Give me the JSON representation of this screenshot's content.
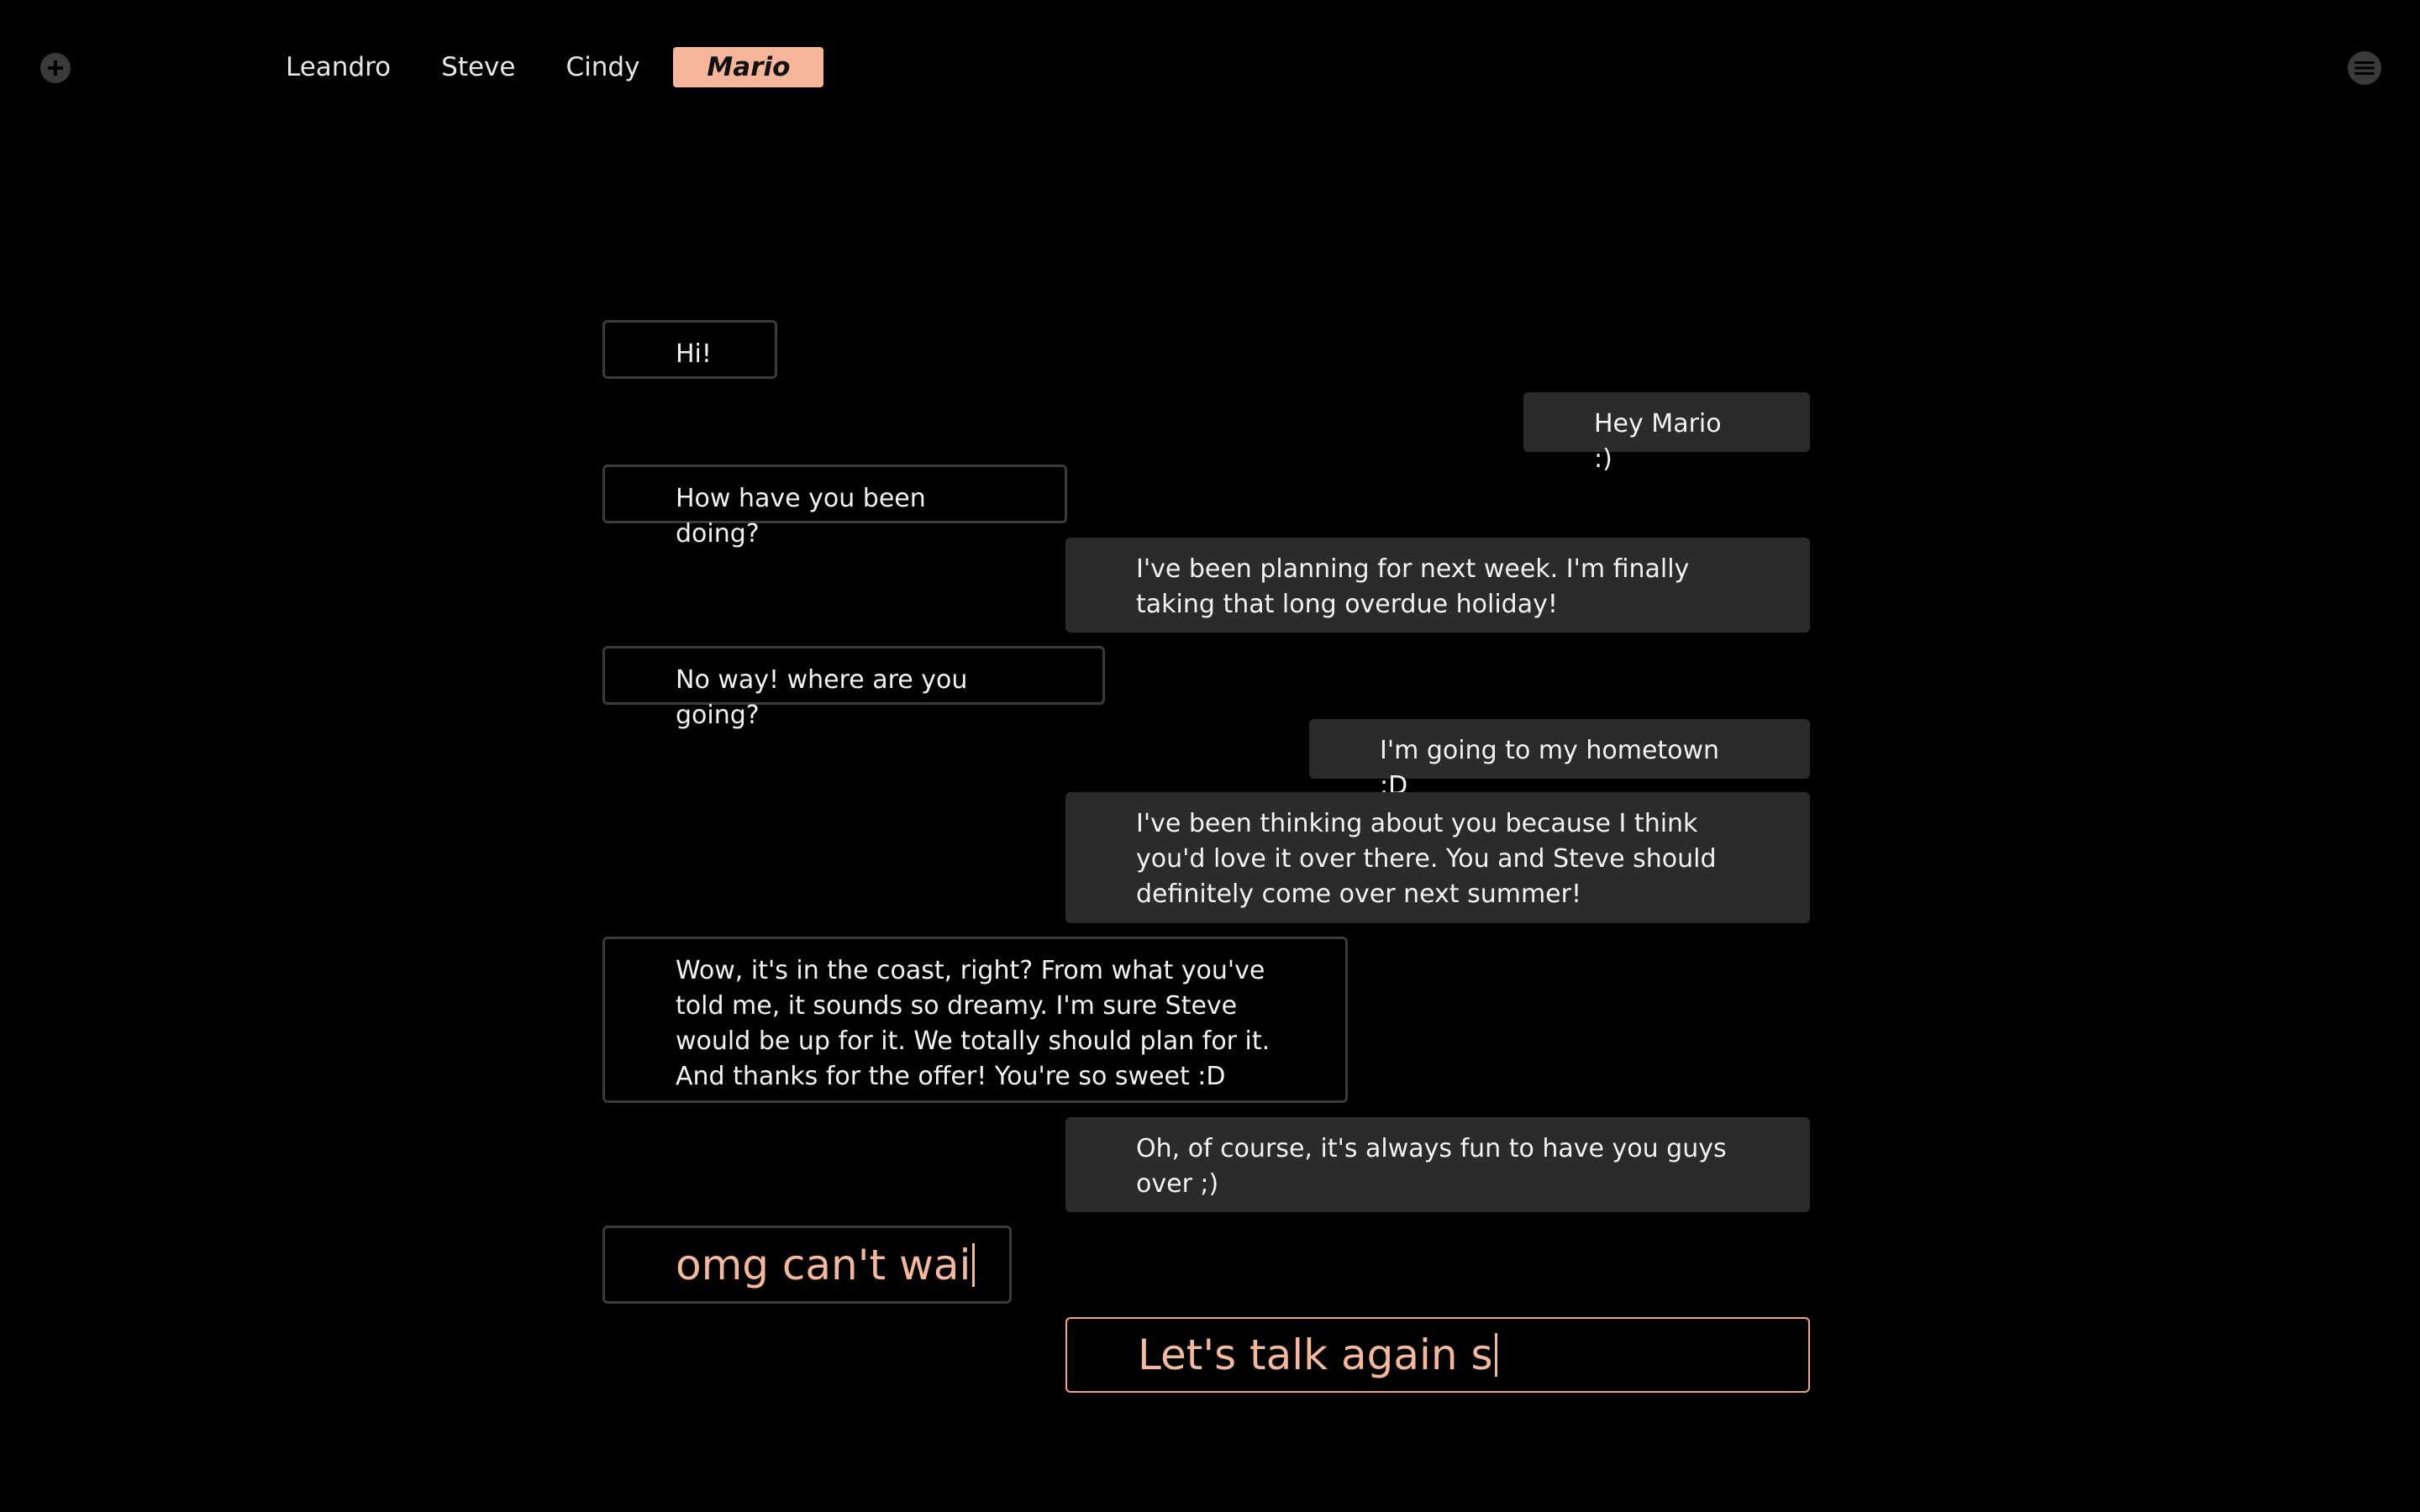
{
  "toolbar": {
    "add_icon": "plus-circle-icon",
    "menu_icon": "hamburger-menu-icon"
  },
  "tabs": [
    {
      "label": "Leandro",
      "active": false
    },
    {
      "label": "Steve",
      "active": false
    },
    {
      "label": "Cindy",
      "active": false
    },
    {
      "label": "Mario",
      "active": true
    }
  ],
  "messages": [
    {
      "from": "them",
      "text": "Hi!"
    },
    {
      "from": "me",
      "text": "Hey Mario :)"
    },
    {
      "from": "them",
      "text": "How have you been doing?"
    },
    {
      "from": "me",
      "text": "I've been planning for next week. I'm finally taking that long overdue holiday!"
    },
    {
      "from": "them",
      "text": "No way! where are you going?"
    },
    {
      "from": "me",
      "text": "I'm going to my hometown :D"
    },
    {
      "from": "me",
      "text": "I've been thinking about you because I think you'd love it over there. You and Steve should definitely come over next summer!"
    },
    {
      "from": "them",
      "text": "Wow, it's in the coast, right? From what you've told me, it sounds so dreamy. I'm sure Steve would be up for it. We totally should plan for it. And thanks for the offer! You're so sweet :D"
    },
    {
      "from": "me",
      "text": "Oh, of course, it's always fun to have you guys over ;)"
    }
  ],
  "drafts": {
    "them": "omg can't wai",
    "me": "Let's talk again s"
  },
  "colors": {
    "background": "#000000",
    "accent": "#f7b59a",
    "outgoing_bubble": "#2b2b2b",
    "incoming_border": "#3b3b3b",
    "draft_text": "#f4b89c"
  }
}
